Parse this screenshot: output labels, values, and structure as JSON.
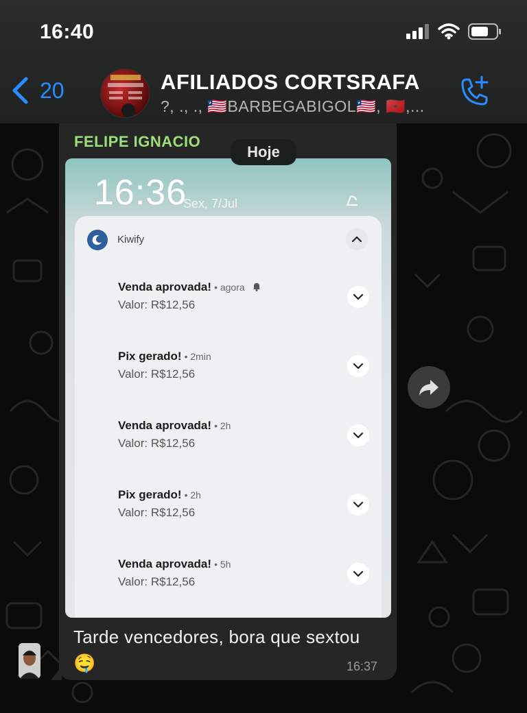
{
  "status_bar": {
    "time": "16:40",
    "icons": [
      "signal-icon",
      "wifi-icon",
      "battery-icon"
    ]
  },
  "header": {
    "back_count": "20",
    "group_name": "AFILIADOS CORTSRAFA",
    "participants": "?, ., ., 🇱🇷BARBEGABIGOL🇱🇷, 🇲🇦,..."
  },
  "chat": {
    "date_chip": "Hoje",
    "message": {
      "sender": "FELIPE IGNACIO",
      "caption": "Tarde vencedores, bora que sextou 🤤",
      "time": "16:37"
    }
  },
  "screenshot": {
    "lock_time": "16:36",
    "lock_date": "Sex, 7/Jul",
    "app_name": "Kiwify",
    "notifications": [
      {
        "title": "Venda aprovada!",
        "meta": "• agora",
        "body": "Valor: R$12,56"
      },
      {
        "title": "Pix gerado!",
        "meta": "• 2min",
        "body": "Valor: R$12,56"
      },
      {
        "title": "Venda aprovada!",
        "meta": "• 2h",
        "body": "Valor: R$12,56"
      },
      {
        "title": "Pix gerado!",
        "meta": "• 2h",
        "body": "Valor: R$12,56"
      },
      {
        "title": "Venda aprovada!",
        "meta": "• 5h",
        "body": "Valor: R$12,56"
      }
    ]
  },
  "colors": {
    "accent_blue": "#2b8cff",
    "sender_green": "#9de07a",
    "bubble": "#262626"
  }
}
